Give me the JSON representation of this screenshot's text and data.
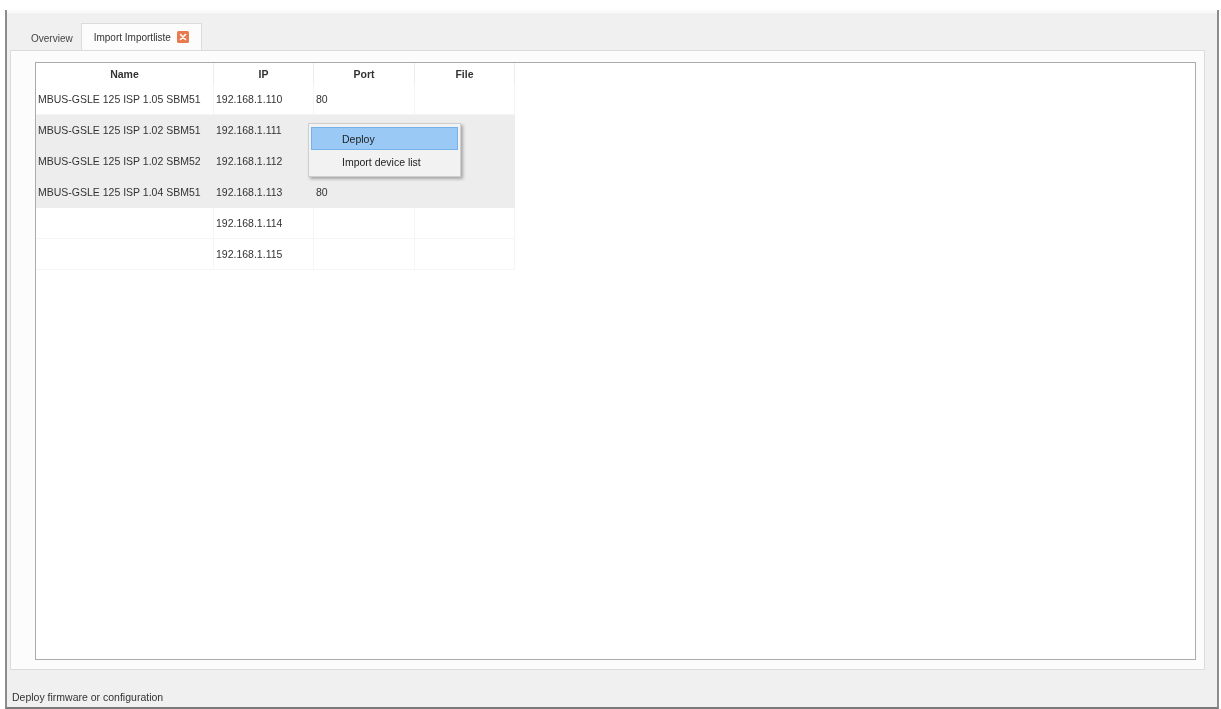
{
  "tabs": [
    {
      "label": "Overview",
      "selected": false,
      "closable": false
    },
    {
      "label": "Import Importliste",
      "selected": true,
      "closable": true
    }
  ],
  "table": {
    "columns": [
      "Name",
      "IP",
      "Port",
      "File"
    ],
    "rows": [
      {
        "name": "MBUS-GSLE 125 ISP 1.05 SBM51",
        "ip": "192.168.1.110",
        "port": "80",
        "selected": false
      },
      {
        "name": "MBUS-GSLE 125 ISP 1.02 SBM51",
        "ip": "192.168.1.111",
        "selected": true
      },
      {
        "name": "MBUS-GSLE 125 ISP 1.02 SBM52",
        "ip": "192.168.1.112",
        "selected": true
      },
      {
        "name": "MBUS-GSLE 125 ISP 1.04 SBM51",
        "ip": "192.168.1.113",
        "port": "80",
        "selected": true
      },
      {
        "ip": "192.168.1.114",
        "selected": false
      },
      {
        "ip": "192.168.1.115",
        "selected": false
      }
    ]
  },
  "context_menu": {
    "items": [
      {
        "label": "Deploy",
        "selected": true
      },
      {
        "label": "Import device list",
        "selected": false
      }
    ]
  },
  "status_bar": {
    "text": "Deploy firmware or configuration"
  }
}
